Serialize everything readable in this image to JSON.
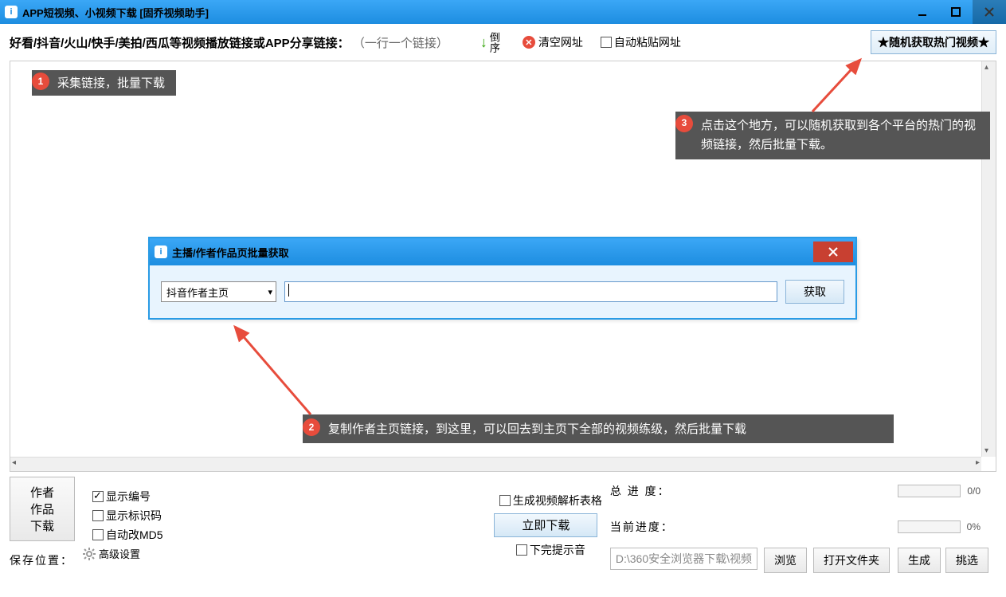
{
  "titlebar": {
    "title": "APP短视频、小视频下载 [固乔视频助手]"
  },
  "toolbar": {
    "hint_main": "好看/抖音/火山/快手/美拍/西瓜等视频播放链接或APP分享链接：",
    "hint_sub": "（一行一个链接）",
    "sort_label": "倒序",
    "clear_url_label": "清空网址",
    "auto_paste_label": "自动粘贴网址",
    "random_hot_label": "★随机获取热门视频★"
  },
  "annotations": {
    "a1": {
      "num": "1",
      "text": "采集链接，批量下载"
    },
    "a2": {
      "num": "2",
      "text": "复制作者主页链接，到这里，可以回去到主页下全部的视频练级，然后批量下载"
    },
    "a3": {
      "num": "3",
      "text": "点击这个地方，可以随机获取到各个平台的热门的视频链接，然后批量下载。"
    }
  },
  "dialog": {
    "title": "主播/作者作品页批量获取",
    "dropdown_selected": "抖音作者主页",
    "fetch_label": "获取"
  },
  "bottom": {
    "total_progress_label": "总 进 度：",
    "total_progress_text": "0/0",
    "current_progress_label": "当前进度：",
    "current_progress_text": "0%",
    "save_location_label": "保存位置：",
    "save_location_path": "D:\\360安全浏览器下载\\视频",
    "browse_label": "浏览",
    "open_folder_label": "打开文件夹",
    "author_works_label": "作者作品下载",
    "generate_label": "生成",
    "pick_label": "挑选",
    "show_number_label": "显示编号",
    "show_id_label": "显示标识码",
    "auto_md5_label": "自动改MD5",
    "advanced_label": "高级设置",
    "parse_table_label": "生成视频解析表格",
    "download_now_label": "立即下载",
    "complete_sound_label": "下完提示音"
  }
}
